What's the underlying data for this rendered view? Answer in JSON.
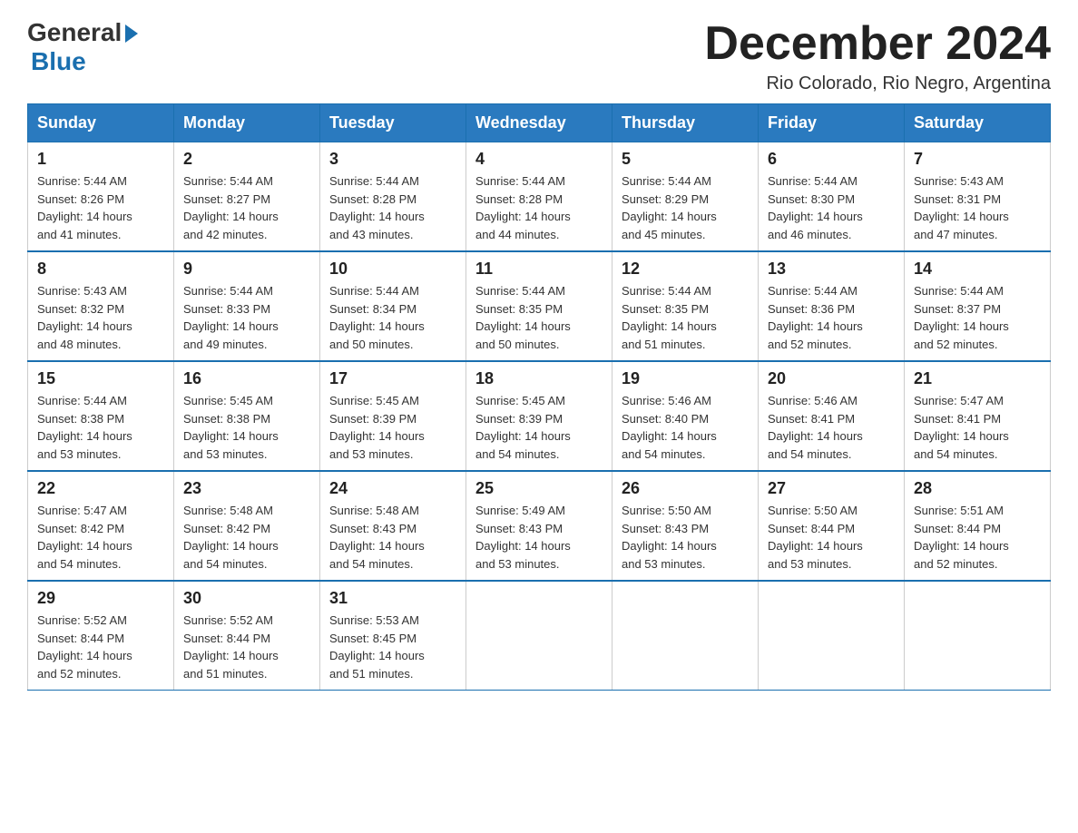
{
  "logo": {
    "general": "General",
    "blue": "Blue"
  },
  "header": {
    "month_year": "December 2024",
    "location": "Rio Colorado, Rio Negro, Argentina"
  },
  "weekdays": [
    "Sunday",
    "Monday",
    "Tuesday",
    "Wednesday",
    "Thursday",
    "Friday",
    "Saturday"
  ],
  "weeks": [
    [
      {
        "day": "1",
        "sunrise": "5:44 AM",
        "sunset": "8:26 PM",
        "daylight": "14 hours and 41 minutes."
      },
      {
        "day": "2",
        "sunrise": "5:44 AM",
        "sunset": "8:27 PM",
        "daylight": "14 hours and 42 minutes."
      },
      {
        "day": "3",
        "sunrise": "5:44 AM",
        "sunset": "8:28 PM",
        "daylight": "14 hours and 43 minutes."
      },
      {
        "day": "4",
        "sunrise": "5:44 AM",
        "sunset": "8:28 PM",
        "daylight": "14 hours and 44 minutes."
      },
      {
        "day": "5",
        "sunrise": "5:44 AM",
        "sunset": "8:29 PM",
        "daylight": "14 hours and 45 minutes."
      },
      {
        "day": "6",
        "sunrise": "5:44 AM",
        "sunset": "8:30 PM",
        "daylight": "14 hours and 46 minutes."
      },
      {
        "day": "7",
        "sunrise": "5:43 AM",
        "sunset": "8:31 PM",
        "daylight": "14 hours and 47 minutes."
      }
    ],
    [
      {
        "day": "8",
        "sunrise": "5:43 AM",
        "sunset": "8:32 PM",
        "daylight": "14 hours and 48 minutes."
      },
      {
        "day": "9",
        "sunrise": "5:44 AM",
        "sunset": "8:33 PM",
        "daylight": "14 hours and 49 minutes."
      },
      {
        "day": "10",
        "sunrise": "5:44 AM",
        "sunset": "8:34 PM",
        "daylight": "14 hours and 50 minutes."
      },
      {
        "day": "11",
        "sunrise": "5:44 AM",
        "sunset": "8:35 PM",
        "daylight": "14 hours and 50 minutes."
      },
      {
        "day": "12",
        "sunrise": "5:44 AM",
        "sunset": "8:35 PM",
        "daylight": "14 hours and 51 minutes."
      },
      {
        "day": "13",
        "sunrise": "5:44 AM",
        "sunset": "8:36 PM",
        "daylight": "14 hours and 52 minutes."
      },
      {
        "day": "14",
        "sunrise": "5:44 AM",
        "sunset": "8:37 PM",
        "daylight": "14 hours and 52 minutes."
      }
    ],
    [
      {
        "day": "15",
        "sunrise": "5:44 AM",
        "sunset": "8:38 PM",
        "daylight": "14 hours and 53 minutes."
      },
      {
        "day": "16",
        "sunrise": "5:45 AM",
        "sunset": "8:38 PM",
        "daylight": "14 hours and 53 minutes."
      },
      {
        "day": "17",
        "sunrise": "5:45 AM",
        "sunset": "8:39 PM",
        "daylight": "14 hours and 53 minutes."
      },
      {
        "day": "18",
        "sunrise": "5:45 AM",
        "sunset": "8:39 PM",
        "daylight": "14 hours and 54 minutes."
      },
      {
        "day": "19",
        "sunrise": "5:46 AM",
        "sunset": "8:40 PM",
        "daylight": "14 hours and 54 minutes."
      },
      {
        "day": "20",
        "sunrise": "5:46 AM",
        "sunset": "8:41 PM",
        "daylight": "14 hours and 54 minutes."
      },
      {
        "day": "21",
        "sunrise": "5:47 AM",
        "sunset": "8:41 PM",
        "daylight": "14 hours and 54 minutes."
      }
    ],
    [
      {
        "day": "22",
        "sunrise": "5:47 AM",
        "sunset": "8:42 PM",
        "daylight": "14 hours and 54 minutes."
      },
      {
        "day": "23",
        "sunrise": "5:48 AM",
        "sunset": "8:42 PM",
        "daylight": "14 hours and 54 minutes."
      },
      {
        "day": "24",
        "sunrise": "5:48 AM",
        "sunset": "8:43 PM",
        "daylight": "14 hours and 54 minutes."
      },
      {
        "day": "25",
        "sunrise": "5:49 AM",
        "sunset": "8:43 PM",
        "daylight": "14 hours and 53 minutes."
      },
      {
        "day": "26",
        "sunrise": "5:50 AM",
        "sunset": "8:43 PM",
        "daylight": "14 hours and 53 minutes."
      },
      {
        "day": "27",
        "sunrise": "5:50 AM",
        "sunset": "8:44 PM",
        "daylight": "14 hours and 53 minutes."
      },
      {
        "day": "28",
        "sunrise": "5:51 AM",
        "sunset": "8:44 PM",
        "daylight": "14 hours and 52 minutes."
      }
    ],
    [
      {
        "day": "29",
        "sunrise": "5:52 AM",
        "sunset": "8:44 PM",
        "daylight": "14 hours and 52 minutes."
      },
      {
        "day": "30",
        "sunrise": "5:52 AM",
        "sunset": "8:44 PM",
        "daylight": "14 hours and 51 minutes."
      },
      {
        "day": "31",
        "sunrise": "5:53 AM",
        "sunset": "8:45 PM",
        "daylight": "14 hours and 51 minutes."
      },
      null,
      null,
      null,
      null
    ]
  ],
  "labels": {
    "sunrise": "Sunrise:",
    "sunset": "Sunset:",
    "daylight": "Daylight:"
  }
}
